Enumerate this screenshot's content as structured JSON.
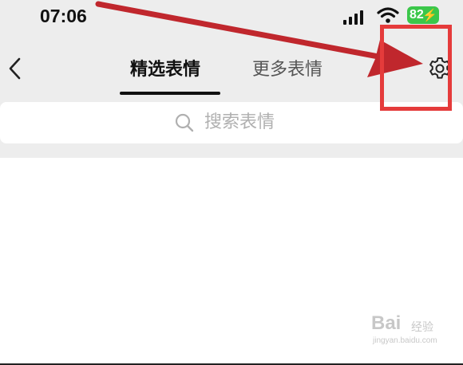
{
  "status_bar": {
    "time": "07:06",
    "battery": "82",
    "icons": [
      "signal-icon",
      "wifi-icon",
      "battery-icon"
    ]
  },
  "header": {
    "back_icon": "chevron-left-icon",
    "tabs": [
      {
        "label": "精选表情",
        "active": true
      },
      {
        "label": "更多表情",
        "active": false
      }
    ],
    "settings_icon": "gear-icon"
  },
  "search": {
    "icon": "search-icon",
    "placeholder": "搜索表情"
  },
  "watermark": {
    "logo": "Bai",
    "cn_text": "经验",
    "url": "jingyan.baidu.com"
  },
  "colors": {
    "header_bg": "#ededed",
    "annotation": "#e53b3b",
    "battery": "#3bc74a",
    "arrow": "#c0272d"
  }
}
